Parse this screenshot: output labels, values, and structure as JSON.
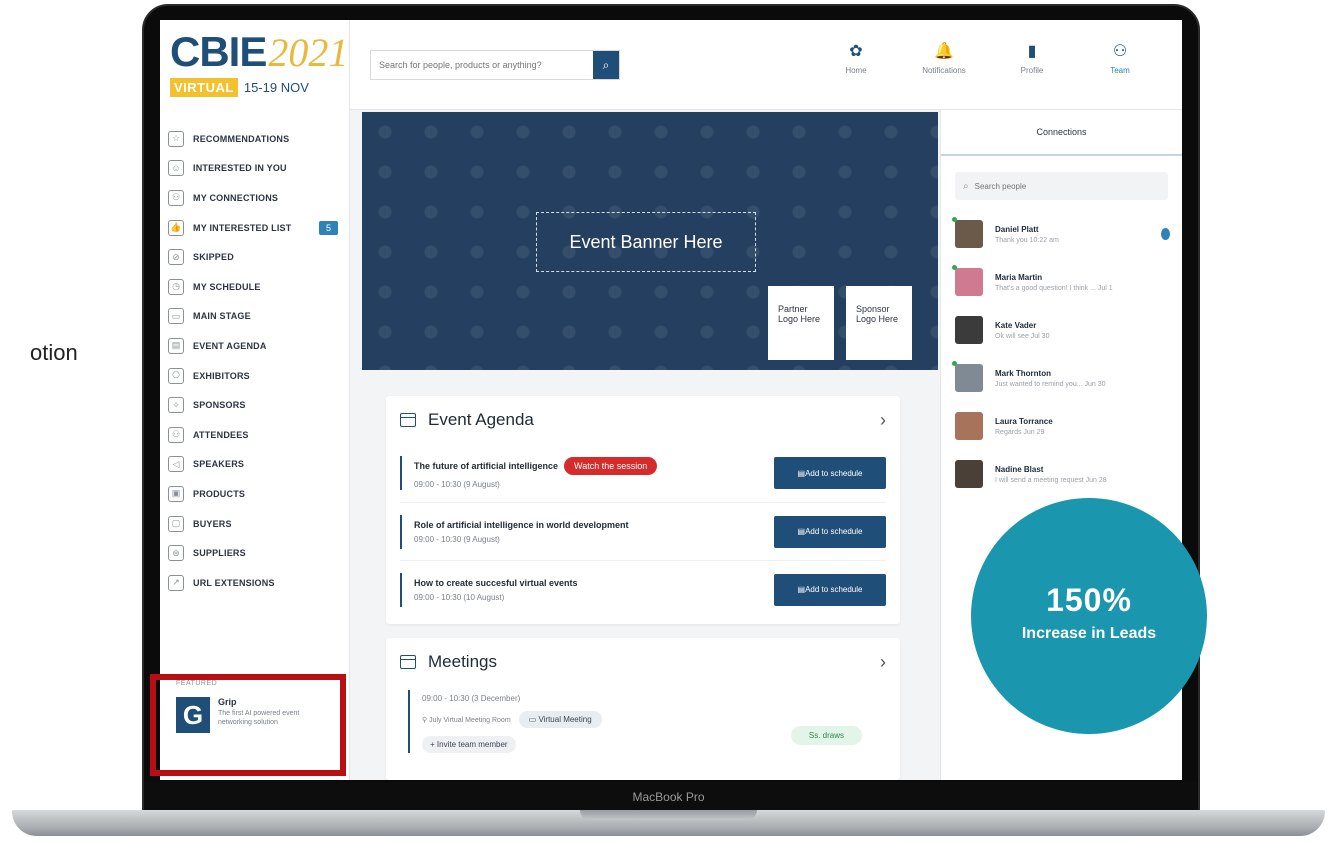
{
  "caption_fragment": "otion",
  "laptop_label": "MacBook Pro",
  "logo": {
    "name": "CBIE",
    "year": "2021",
    "virtual": "VIRTUAL",
    "dates": "15-19 NOV"
  },
  "sidebar": {
    "items": [
      {
        "label": "RECOMMENDATIONS",
        "icon": "star-icon",
        "glyph": "☆"
      },
      {
        "label": "INTERESTED IN YOU",
        "icon": "smiley-icon",
        "glyph": "☺"
      },
      {
        "label": "MY CONNECTIONS",
        "icon": "people-icon",
        "glyph": "⚇"
      },
      {
        "label": "MY INTERESTED LIST",
        "icon": "thumbs-up-icon",
        "glyph": "👍",
        "badge": "5"
      },
      {
        "label": "SKIPPED",
        "icon": "skip-icon",
        "glyph": "⊘"
      },
      {
        "label": "MY SCHEDULE",
        "icon": "schedule-icon",
        "glyph": "◷"
      },
      {
        "label": "MAIN STAGE",
        "icon": "stage-icon",
        "glyph": "▭"
      },
      {
        "label": "EVENT AGENDA",
        "icon": "calendar-icon",
        "glyph": "▤"
      },
      {
        "label": "EXHIBITORS",
        "icon": "exhibitor-icon",
        "glyph": "⎔"
      },
      {
        "label": "SPONSORS",
        "icon": "sponsor-icon",
        "glyph": "✧"
      },
      {
        "label": "ATTENDEES",
        "icon": "attendees-icon",
        "glyph": "⚇"
      },
      {
        "label": "SPEAKERS",
        "icon": "speaker-icon",
        "glyph": "◁"
      },
      {
        "label": "PRODUCTS",
        "icon": "product-icon",
        "glyph": "▣"
      },
      {
        "label": "BUYERS",
        "icon": "buyer-icon",
        "glyph": "▢"
      },
      {
        "label": "SUPPLIERS",
        "icon": "supplier-icon",
        "glyph": "⊛"
      },
      {
        "label": "URL EXTENSIONS",
        "icon": "external-link-icon",
        "glyph": "↗"
      }
    ],
    "featured": {
      "label": "FEATURED",
      "name": "Grip",
      "logo_letter": "G",
      "description": "The first AI powered event networking solution"
    }
  },
  "topbar": {
    "search_placeholder": "Search for people, products or anything?",
    "nav": [
      {
        "label": "Home",
        "icon": "home-icon",
        "glyph": "✿"
      },
      {
        "label": "Notifications",
        "icon": "bell-icon",
        "glyph": "🔔"
      },
      {
        "label": "Profile",
        "icon": "profile-icon",
        "glyph": "▮"
      },
      {
        "label": "Team",
        "icon": "team-icon",
        "glyph": "⚇",
        "active": true
      }
    ]
  },
  "banner": {
    "text": "Event Banner Here",
    "partner": "Partner Logo Here",
    "sponsor": "Sponsor Logo Here"
  },
  "agenda": {
    "title": "Event Agenda",
    "watch_label": "Watch the session",
    "button_label": "Add to schedule",
    "rows": [
      {
        "title": "The future of artificial intelligence",
        "time": "09:00 - 10:30 (9 August)",
        "watch": true
      },
      {
        "title": "Role of artificial intelligence in world development",
        "time": "09:00 - 10:30 (9 August)",
        "watch": false
      },
      {
        "title": "How to create succesful virtual events",
        "time": "09:00 - 10:30 (10 August)",
        "watch": false
      }
    ]
  },
  "meetings": {
    "title": "Meetings",
    "time": "09:00 - 10:30 (3 December)",
    "room": "July Virtual Meeting Room",
    "type": "Virtual Meeting",
    "invite": "+ Invite team member",
    "status": "Ss. draws"
  },
  "connections": {
    "title": "Connections",
    "search_placeholder": "Search people",
    "people": [
      {
        "name": "Daniel Platt",
        "msg": "Thank you  10:22 am",
        "online": true,
        "unread": true,
        "color": "#6b5a4a"
      },
      {
        "name": "Maria Martin",
        "msg": "That's a good question! I think ... Jul 1",
        "online": true,
        "unread": false,
        "color": "#d07a92"
      },
      {
        "name": "Kate Vader",
        "msg": "Ok will see  Jul 30",
        "online": false,
        "unread": false,
        "color": "#3b3b3b"
      },
      {
        "name": "Mark Thornton",
        "msg": "Just wanted to remind you... Jun 30",
        "online": true,
        "unread": false,
        "color": "#7f8a94"
      },
      {
        "name": "Laura Torrance",
        "msg": "Regards  Jun 29",
        "online": false,
        "unread": false,
        "color": "#a7735a"
      },
      {
        "name": "Nadine Blast",
        "msg": "I will send a meeting request  Jun 28",
        "online": false,
        "unread": false,
        "color": "#4a4038"
      }
    ]
  },
  "stat": {
    "value": "150%",
    "label": "Increase in Leads"
  },
  "colors": {
    "brand": "#1f4e79",
    "banner": "#243f5f",
    "stat": "#1a96ae",
    "highlight": "#b80f14",
    "alert": "#d62b2b"
  }
}
